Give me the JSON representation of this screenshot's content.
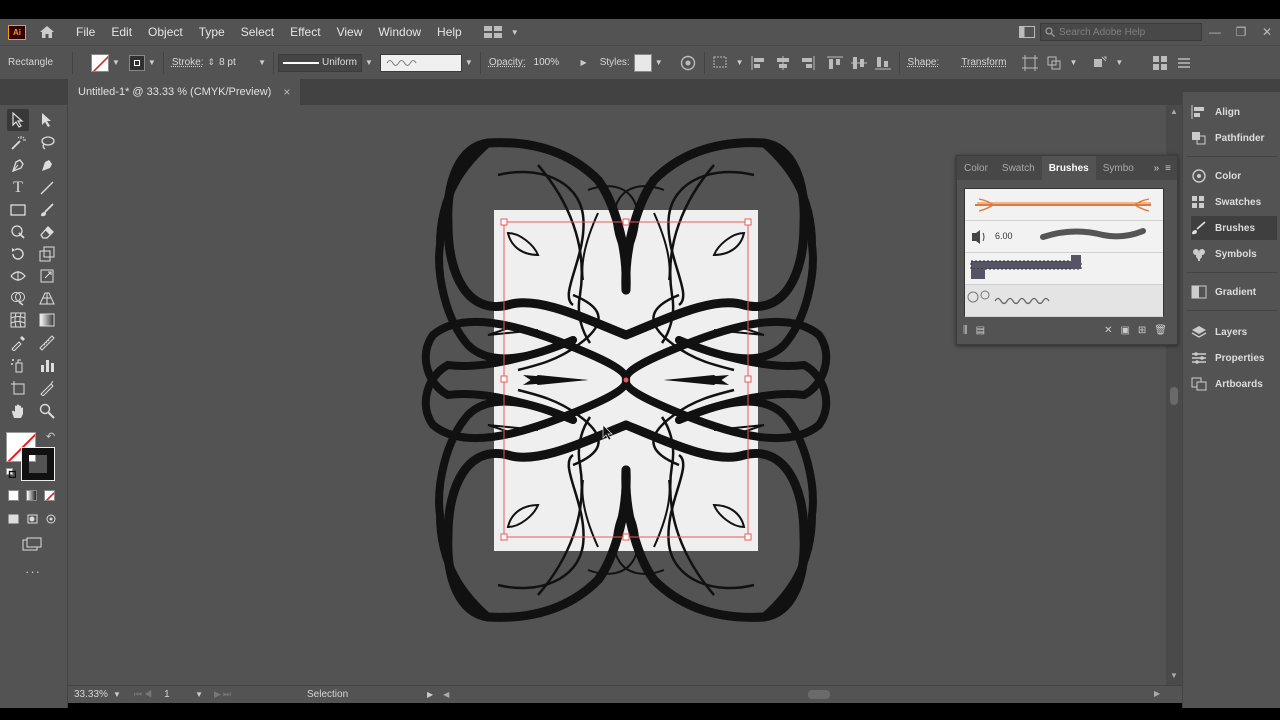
{
  "app": {
    "logo_text": "Ai"
  },
  "menu": {
    "items": [
      "File",
      "Edit",
      "Object",
      "Type",
      "Select",
      "Effect",
      "View",
      "Window",
      "Help"
    ],
    "search_placeholder": "Search Adobe Help"
  },
  "control_bar": {
    "object_type": "Rectangle",
    "stroke_label": "Stroke:",
    "stroke_value": "8 pt",
    "profile_label": "Uniform",
    "opacity_label": "Opacity:",
    "opacity_value": "100%",
    "styles_label": "Styles:",
    "shape_label": "Shape:",
    "transform_label": "Transform"
  },
  "document": {
    "tab_title": "Untitled-1* @ 33.33 % (CMYK/Preview)",
    "close_glyph": "×"
  },
  "status_bar": {
    "zoom": "33.33%",
    "artboard_number": "1",
    "tool_status": "Selection"
  },
  "brushes_panel": {
    "tabs": [
      "Color",
      "Swatch",
      "Brushes",
      "Symbo"
    ],
    "active_tab": "Brushes",
    "brush_size": "6.00"
  },
  "dock": {
    "groups": [
      [
        "Align",
        "Pathfinder"
      ],
      [
        "Color",
        "Swatches",
        "Brushes",
        "Symbols"
      ],
      [
        "Gradient"
      ],
      [
        "Layers",
        "Properties",
        "Artboards"
      ]
    ],
    "active_item": "Brushes"
  },
  "colors": {
    "ui_background": "#535353",
    "artboard": "#efefef",
    "selection": "#e8585a",
    "artwork": "#111111",
    "brush_accent": "#e07a3a"
  }
}
